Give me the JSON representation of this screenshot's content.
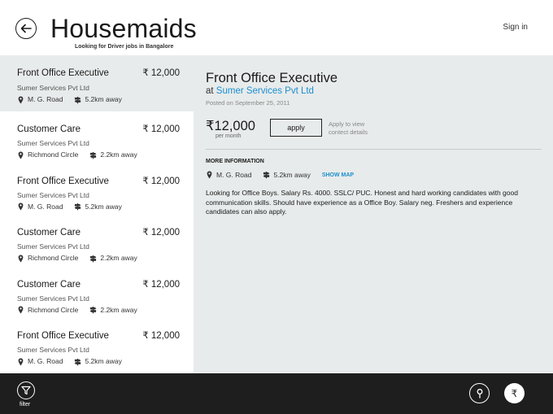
{
  "header": {
    "title": "Housemaids",
    "subtitle": "Looking for Driver jobs in Bangalore",
    "sign_in": "Sign in"
  },
  "jobs": [
    {
      "title": "Front Office Executive",
      "salary": "₹ 12,000",
      "company": "Sumer Services Pvt Ltd",
      "location": "M. G. Road",
      "distance": "5.2km away",
      "selected": true
    },
    {
      "title": "Customer Care",
      "salary": "₹ 12,000",
      "company": "Sumer Services Pvt Ltd",
      "location": "Richmond Circle",
      "distance": "2.2km away",
      "selected": false
    },
    {
      "title": "Front Office Executive",
      "salary": "₹ 12,000",
      "company": "Sumer Services Pvt Ltd",
      "location": "M. G. Road",
      "distance": "5.2km away",
      "selected": false
    },
    {
      "title": "Customer Care",
      "salary": "₹ 12,000",
      "company": "Sumer Services Pvt Ltd",
      "location": "Richmond Circle",
      "distance": "2.2km away",
      "selected": false
    },
    {
      "title": "Customer Care",
      "salary": "₹ 12,000",
      "company": "Sumer Services Pvt Ltd",
      "location": "Richmond Circle",
      "distance": "2.2km away",
      "selected": false
    },
    {
      "title": "Front Office Executive",
      "salary": "₹ 12,000",
      "company": "Sumer Services Pvt Ltd",
      "location": "M. G. Road",
      "distance": "5.2km away",
      "selected": false
    }
  ],
  "detail": {
    "title": "Front Office Executive",
    "at": "at",
    "company": "Sumer Services Pvt Ltd",
    "posted": "Posted on September 25, 2011",
    "salary": "₹12,000",
    "per_month": "per month",
    "apply_label": "apply",
    "apply_hint": "Apply to view contect details",
    "more_info": "MORE INFORMATION",
    "location": "M. G. Road",
    "distance": "5.2km away",
    "show_map": "SHOW MAP",
    "description": "Looking for Office Boys. Salary Rs. 4000. SSLC/ PUC. Honest and hard working candidates with good communication skills. Should have experience as a Office Boy. Salary neg. Freshers and experience candidates can also apply."
  },
  "appbar": {
    "filter_label": "filter",
    "rupee_symbol": "₹"
  },
  "colors": {
    "accent": "#1b8fcf",
    "detail_bg": "#e8ebeb",
    "appbar_bg": "#1e1e1e"
  }
}
